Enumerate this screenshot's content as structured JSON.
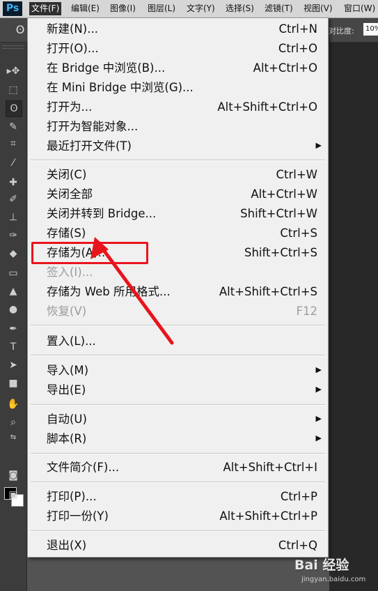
{
  "app": {
    "logo": "Ps",
    "menubar": [
      {
        "label": "文件(F)",
        "active": true
      },
      {
        "label": "编辑(E)",
        "active": false
      },
      {
        "label": "图像(I)",
        "active": false
      },
      {
        "label": "图层(L)",
        "active": false
      },
      {
        "label": "文字(Y)",
        "active": false
      },
      {
        "label": "选择(S)",
        "active": false
      },
      {
        "label": "滤镜(T)",
        "active": false
      },
      {
        "label": "视图(V)",
        "active": false
      },
      {
        "label": "窗口(W)",
        "active": false
      }
    ]
  },
  "options": {
    "contrast_label": "对比度:",
    "contrast_value": "10%"
  },
  "file_menu": {
    "items": [
      {
        "label": "新建(N)...",
        "shortcut": "Ctrl+N"
      },
      {
        "label": "打开(O)...",
        "shortcut": "Ctrl+O"
      },
      {
        "label": "在 Bridge 中浏览(B)...",
        "shortcut": "Alt+Ctrl+O"
      },
      {
        "label": "在 Mini Bridge 中浏览(G)...",
        "shortcut": ""
      },
      {
        "label": "打开为...",
        "shortcut": "Alt+Shift+Ctrl+O"
      },
      {
        "label": "打开为智能对象...",
        "shortcut": ""
      },
      {
        "label": "最近打开文件(T)",
        "shortcut": ""
      },
      {
        "label": "关闭(C)",
        "shortcut": "Ctrl+W"
      },
      {
        "label": "关闭全部",
        "shortcut": "Alt+Ctrl+W"
      },
      {
        "label": "关闭并转到 Bridge...",
        "shortcut": "Shift+Ctrl+W"
      },
      {
        "label": "存储(S)",
        "shortcut": "Ctrl+S"
      },
      {
        "label": "存储为(A)...",
        "shortcut": "Shift+Ctrl+S"
      },
      {
        "label": "签入(I)...",
        "shortcut": ""
      },
      {
        "label": "存储为 Web 所用格式...",
        "shortcut": "Alt+Shift+Ctrl+S"
      },
      {
        "label": "恢复(V)",
        "shortcut": "F12"
      },
      {
        "label": "置入(L)...",
        "shortcut": ""
      },
      {
        "label": "导入(M)",
        "shortcut": ""
      },
      {
        "label": "导出(E)",
        "shortcut": ""
      },
      {
        "label": "自动(U)",
        "shortcut": ""
      },
      {
        "label": "脚本(R)",
        "shortcut": ""
      },
      {
        "label": "文件简介(F)...",
        "shortcut": "Alt+Shift+Ctrl+I"
      },
      {
        "label": "打印(P)...",
        "shortcut": "Ctrl+P"
      },
      {
        "label": "打印一份(Y)",
        "shortcut": "Alt+Shift+Ctrl+P"
      },
      {
        "label": "退出(X)",
        "shortcut": "Ctrl+Q"
      }
    ],
    "highlighted_item": "存储为(A)...",
    "highlight_color": "#e8141c"
  },
  "watermark": {
    "logo": "Bai 经验",
    "url": "jingyan.baidu.com"
  }
}
